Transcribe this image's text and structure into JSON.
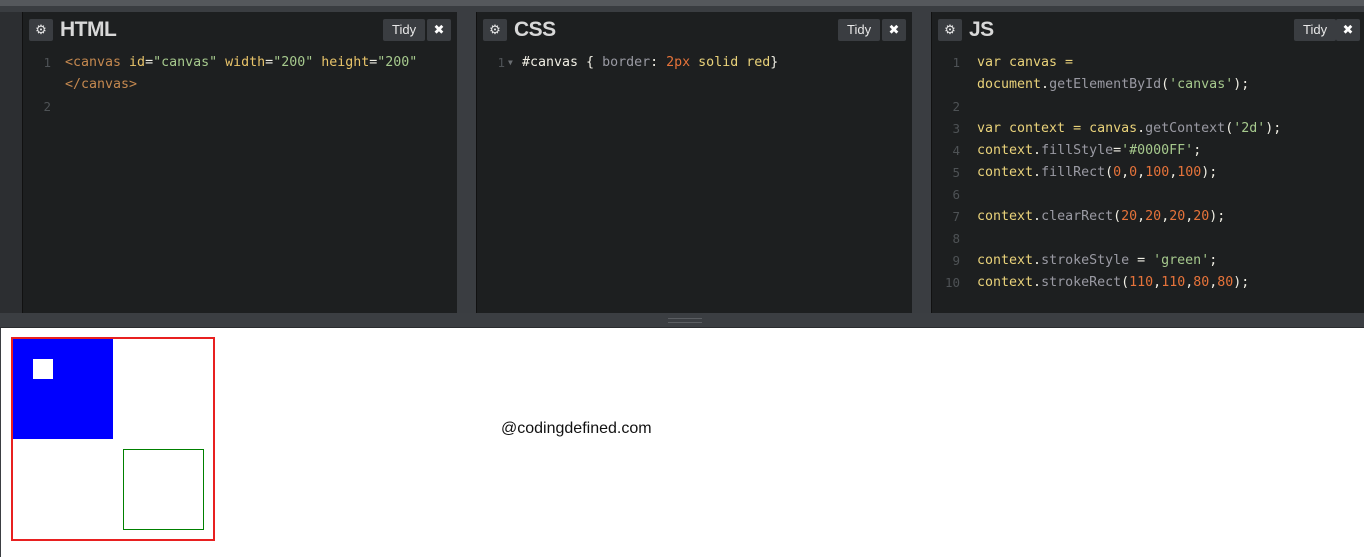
{
  "panels": {
    "html": {
      "title": "HTML",
      "tidy_label": "Tidy",
      "settings_icon": "gear-icon",
      "close_icon": "close-icon",
      "line_numbers": [
        "1",
        "2"
      ]
    },
    "css": {
      "title": "CSS",
      "tidy_label": "Tidy",
      "settings_icon": "gear-icon",
      "close_icon": "close-icon",
      "line_numbers": [
        "1"
      ],
      "fold_icon": "fold-arrow-icon"
    },
    "js": {
      "title": "JS",
      "tidy_label": "Tidy",
      "settings_icon": "gear-icon",
      "close_icon": "close-icon",
      "line_numbers": [
        "1",
        "2",
        "3",
        "4",
        "5",
        "6",
        "7",
        "8",
        "9",
        "10"
      ]
    }
  },
  "code": {
    "html_l1a_open": "<canvas ",
    "html_l1a_id": "id",
    "html_l1a_eq1": "=",
    "html_l1a_idval": "\"canvas\"",
    "html_l1a_w": " width",
    "html_l1a_eq2": "=",
    "html_l1a_wval": "\"200\"",
    "html_l1a_h": " height",
    "html_l1a_eq3": "=",
    "html_l1a_hval": "\"200\"",
    "html_l1b_close": "</canvas>",
    "css_sel": "#canvas",
    "css_ob": " { ",
    "css_prop": "border",
    "css_colon": ": ",
    "css_num": "2px",
    "css_rest": " solid red",
    "css_cb": "}",
    "js_1a": "var canvas =",
    "js_1b_obj": "document",
    "js_1b_dot": ".",
    "js_1b_fn": "getElementById",
    "js_1b_op": "(",
    "js_1b_str": "'canvas'",
    "js_1b_cl": ");",
    "js_3_var": "var context = canvas",
    "js_3_dot": ".",
    "js_3_fn": "getContext",
    "js_3_op": "(",
    "js_3_str": "'2d'",
    "js_3_cl": ");",
    "js_4_obj": "context",
    "js_4_dot": ".",
    "js_4_prop": "fillStyle",
    "js_4_eq": "=",
    "js_4_str": "'#0000FF'",
    "js_4_semi": ";",
    "js_5_obj": "context",
    "js_5_dot": ".",
    "js_5_fn": "fillRect",
    "js_5_op": "(",
    "js_5_n1": "0",
    "js_5_c1": ",",
    "js_5_n2": "0",
    "js_5_c2": ",",
    "js_5_n3": "100",
    "js_5_c3": ",",
    "js_5_n4": "100",
    "js_5_cl": ");",
    "js_7_obj": "context",
    "js_7_dot": ".",
    "js_7_fn": "clearRect",
    "js_7_op": "(",
    "js_7_n1": "20",
    "js_7_c1": ",",
    "js_7_n2": "20",
    "js_7_c2": ",",
    "js_7_n3": "20",
    "js_7_c3": ",",
    "js_7_n4": "20",
    "js_7_cl": ");",
    "js_9_obj": "context",
    "js_9_dot": ".",
    "js_9_prop": "strokeStyle",
    "js_9_eq": " = ",
    "js_9_str": "'green'",
    "js_9_semi": ";",
    "js_10_obj": "context",
    "js_10_dot": ".",
    "js_10_fn": "strokeRect",
    "js_10_op": "(",
    "js_10_n1": "110",
    "js_10_c1": ",",
    "js_10_n2": "110",
    "js_10_c2": ",",
    "js_10_n3": "80",
    "js_10_c3": ",",
    "js_10_n4": "80",
    "js_10_cl": ");"
  },
  "result": {
    "watermark": "@codingdefined.com",
    "canvas": {
      "width": 200,
      "height": 200,
      "border_color": "#e82020",
      "fill_color": "#0000FF",
      "fill_rect": [
        0,
        0,
        100,
        100
      ],
      "clear_rect": [
        20,
        20,
        20,
        20
      ],
      "stroke_color": "green",
      "stroke_rect": [
        110,
        110,
        80,
        80
      ]
    }
  },
  "colors": {
    "editor_bg": "#1d1f20",
    "chrome_bg": "#3a3d41",
    "keyword": "#e9d27a",
    "string": "#a6c98d",
    "number": "#e6733a",
    "tag": "#c4884f"
  }
}
